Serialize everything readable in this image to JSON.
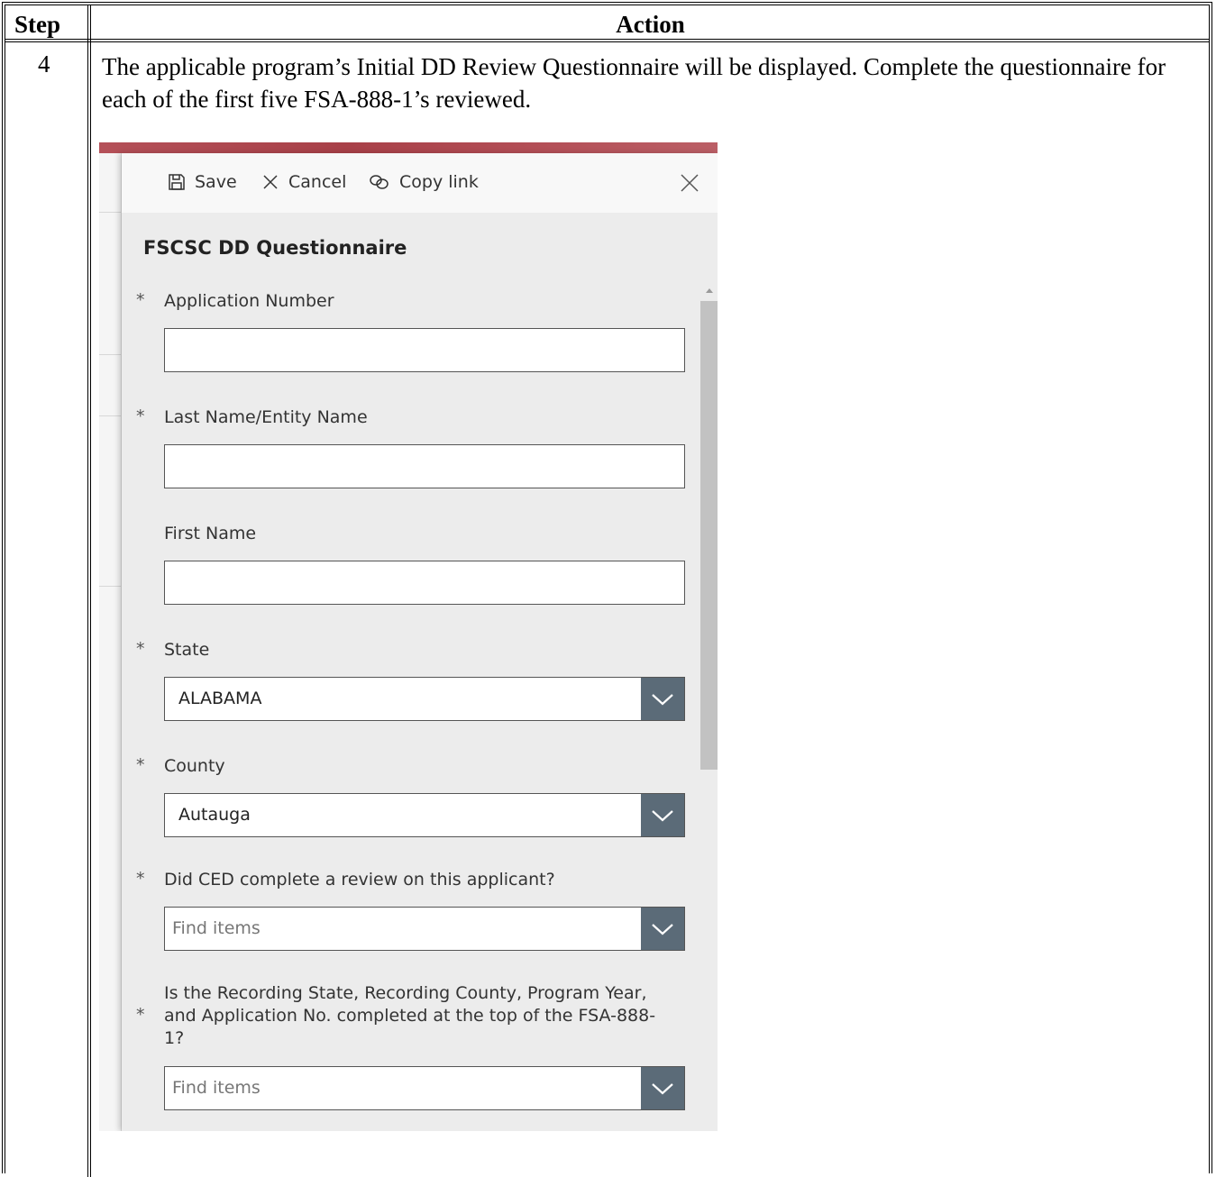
{
  "table": {
    "header_step": "Step",
    "header_action": "Action",
    "row": {
      "step": "4",
      "text": "The applicable program’s Initial DD Review Questionnaire will be displayed.  Complete the questionnaire for each of the first five FSA-888-1’s reviewed."
    }
  },
  "screenshot": {
    "toolbar": {
      "save_label": "Save",
      "cancel_label": "Cancel",
      "copy_link_label": "Copy link"
    },
    "form_title": "FSCSC DD Questionnaire",
    "required_marker": "*",
    "fields": {
      "application_number": {
        "label": "Application Number",
        "value": ""
      },
      "last_name": {
        "label": "Last Name/Entity Name",
        "value": ""
      },
      "first_name": {
        "label": "First Name",
        "value": ""
      },
      "state": {
        "label": "State",
        "value": "ALABAMA"
      },
      "county": {
        "label": "County",
        "value": "Autauga"
      },
      "ced_review": {
        "label": "Did CED complete a review on this applicant?",
        "placeholder": "Find items"
      },
      "recording_state": {
        "label_line1": "Is the Recording State, Recording County, Program Year,",
        "label_line2": "and Application No. completed at the top of the FSA-888-",
        "label_line3": "1?",
        "placeholder": "Find items"
      }
    },
    "icons": [
      "save-icon",
      "cancel-icon",
      "link-icon",
      "close-icon",
      "chevron-down-icon"
    ]
  }
}
